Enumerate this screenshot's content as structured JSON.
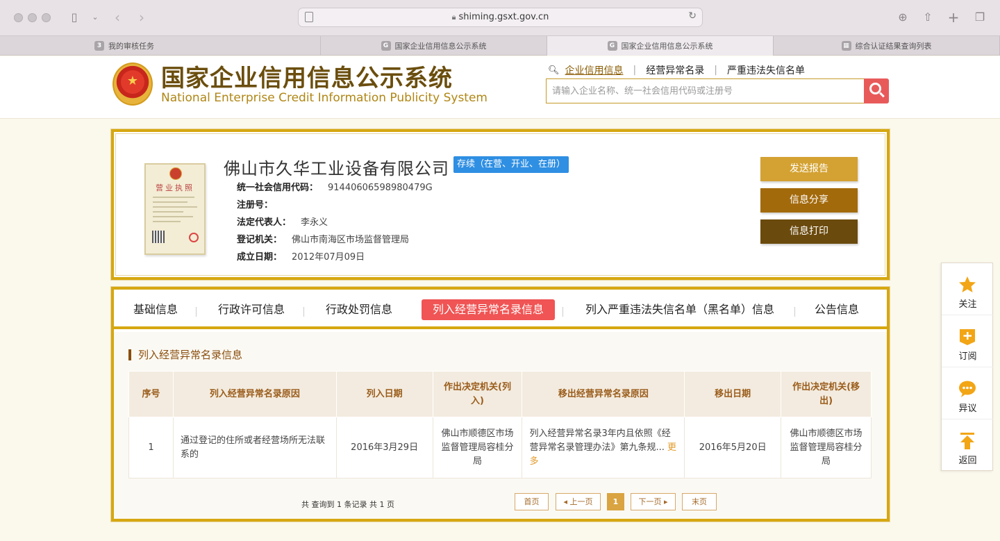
{
  "browser": {
    "url": "shiming.gsxt.gov.cn",
    "tabs": [
      {
        "label": "我的审核任务",
        "fav": "3"
      },
      {
        "label": "国家企业信用信息公示系统",
        "fav": "G"
      },
      {
        "label": "国家企业信用信息公示系统",
        "fav": "G"
      },
      {
        "label": "综合认证结果查询列表",
        "fav": "▦"
      }
    ]
  },
  "header": {
    "title": "国家企业信用信息公示系统",
    "subtitle": "National Enterprise Credit Information Publicity System",
    "nav": [
      "企业信用信息",
      "经营异常名录",
      "严重违法失信名单"
    ],
    "search_placeholder": "请输入企业名称、统一社会信用代码或注册号"
  },
  "company": {
    "license_title": "营业执照",
    "name": "佛山市久华工业设备有限公司",
    "status": "存续（在营、开业、在册）",
    "fields": [
      {
        "label": "统一社会信用代码：",
        "value": "91440606598980479G"
      },
      {
        "label": "注册号：",
        "value": ""
      },
      {
        "label": "法定代表人：",
        "value": "李永义"
      },
      {
        "label": "登记机关：",
        "value": "佛山市南海区市场监督管理局"
      },
      {
        "label": "成立日期：",
        "value": "2012年07月09日"
      }
    ],
    "actions": [
      "发送报告",
      "信息分享",
      "信息打印"
    ],
    "action_colors": [
      "#d4a232",
      "#a36a0c",
      "#6b4a0d"
    ]
  },
  "detail_tabs": [
    "基础信息",
    "行政许可信息",
    "行政处罚信息",
    "列入经营异常名录信息",
    "列入严重违法失信名单（黑名单）信息",
    "公告信息"
  ],
  "abnormal": {
    "section_title": "列入经营异常名录信息",
    "headers": [
      "序号",
      "列入经营异常名录原因",
      "列入日期",
      "作出决定机关(列入)",
      "移出经营异常名录原因",
      "移出日期",
      "作出决定机关(移出)"
    ],
    "rows": [
      {
        "index": "1",
        "reason_in": "通过登记的住所或者经营场所无法联系的",
        "date_in": "2016年3月29日",
        "authority_in": "佛山市顺德区市场监督管理局容桂分局",
        "reason_out": "列入经营异常名录3年内且依照《经营异常名录管理办法》第九条规...",
        "more": "更多",
        "date_out": "2016年5月20日",
        "authority_out": "佛山市顺德区市场监督管理局容桂分局"
      }
    ],
    "pager": {
      "total_text": "共 查询到 1 条记录 共 1 页",
      "first": "首页",
      "prev": "◂ 上一页",
      "current": "1",
      "next": "下一页 ▸",
      "last": "末页"
    }
  },
  "side_toolbar": [
    {
      "label": "关注",
      "icon": "star-icon"
    },
    {
      "label": "订阅",
      "icon": "subscribe-icon"
    },
    {
      "label": "异议",
      "icon": "chat-icon"
    },
    {
      "label": "返回",
      "icon": "back-top-icon"
    }
  ],
  "accent": {
    "gold": "#d6a710",
    "red": "#f05454",
    "blue": "#2f8fe3"
  }
}
